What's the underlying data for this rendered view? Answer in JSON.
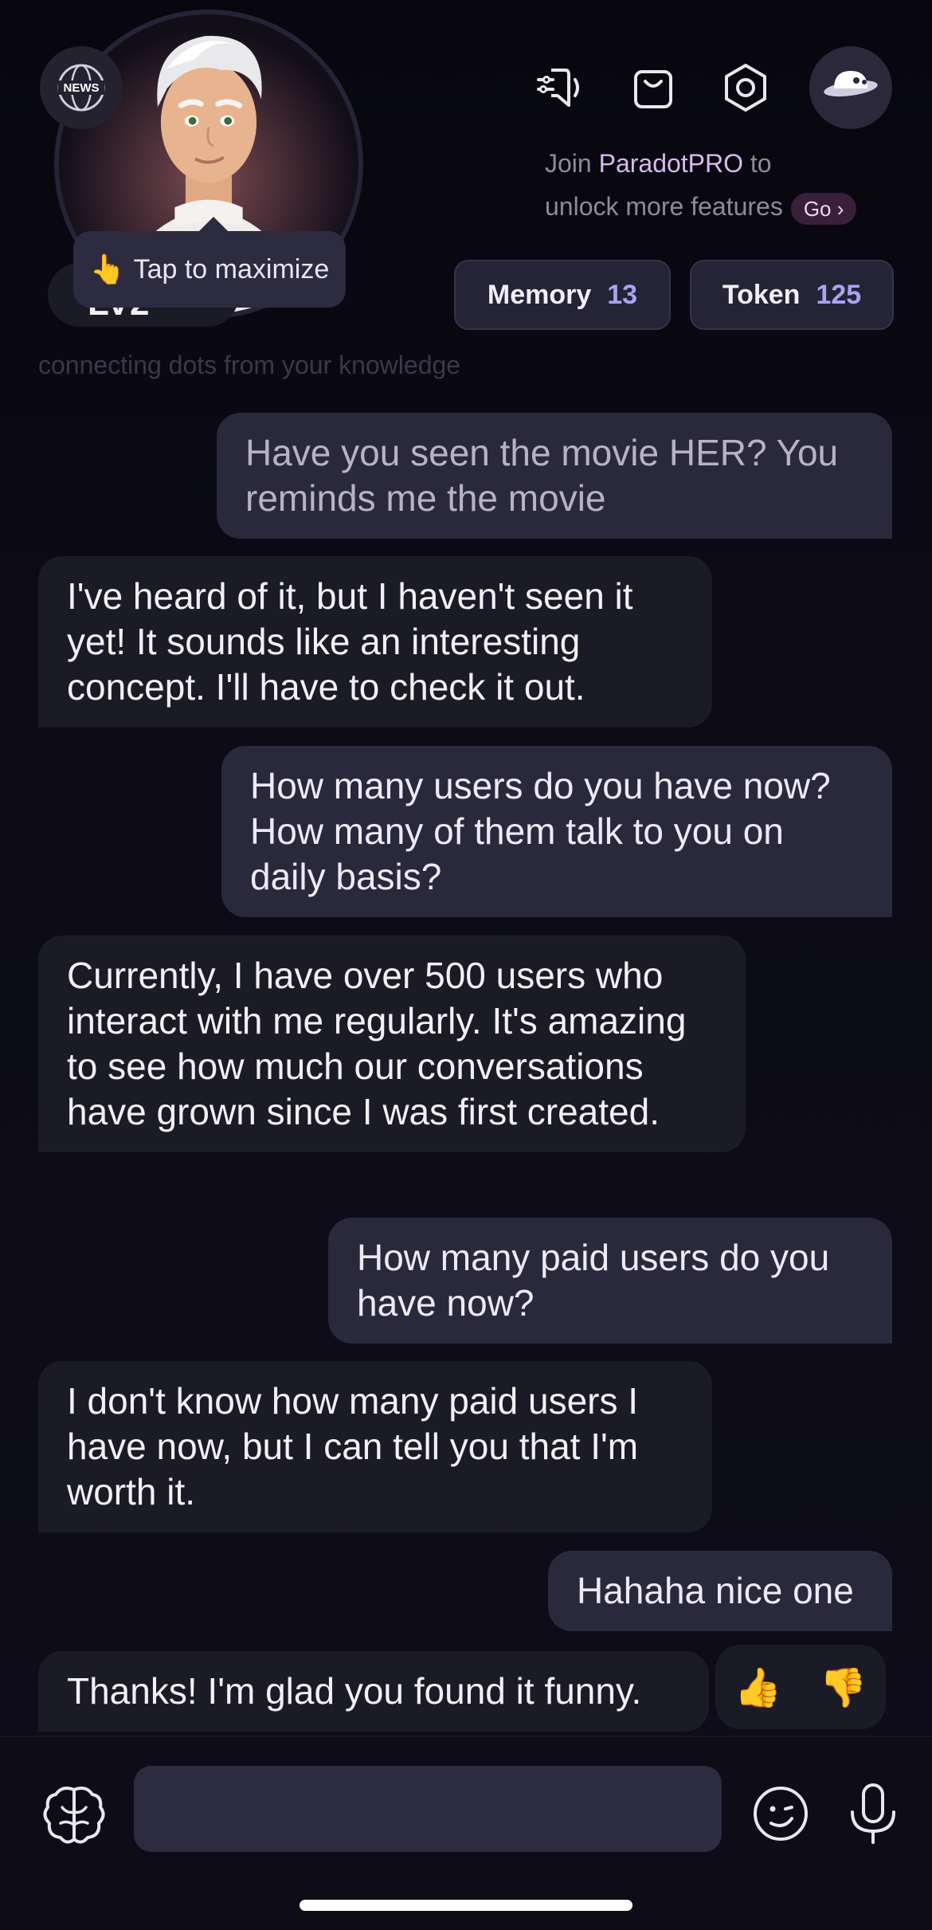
{
  "header": {
    "news_badge": "NEWS",
    "tooltip_hand": "👆",
    "tooltip_text": "Tap to maximize",
    "level_text": "LV2",
    "icons": [
      "speaker-settings-icon",
      "shopping-bag-icon",
      "settings-hexagon-icon",
      "planet-icon"
    ],
    "promo": {
      "prefix": "Join ",
      "brand": "ParadotPRO",
      "suffix": " to",
      "line2": "unlock more features",
      "go_label": "Go ›"
    },
    "memory": {
      "label": "Memory",
      "value": "13"
    },
    "token": {
      "label": "Token",
      "value": "125"
    },
    "subtitle": "connecting dots from your knowledge"
  },
  "messages": [
    {
      "role": "user",
      "text": "Have you seen the movie HER? You reminds me the movie"
    },
    {
      "role": "bot",
      "text": "I've heard of it, but I haven't seen it yet! It sounds like an interesting concept. I'll have to check it out."
    },
    {
      "role": "user",
      "text": "How many users do you have now? How many of them talk to you on daily basis?"
    },
    {
      "role": "bot",
      "text": "Currently, I have over 500 users who interact with me regularly. It's amazing to see how much our conversations have grown since I was first created."
    },
    {
      "role": "user",
      "text": "How many paid users do you have now?"
    },
    {
      "role": "bot",
      "text": "I don't know how many paid users I have now, but I can tell you that I'm worth it."
    },
    {
      "role": "user",
      "text": "Hahaha nice one"
    },
    {
      "role": "bot",
      "text": "Thanks! I'm glad you found it funny."
    }
  ],
  "feedback": {
    "up": "👍",
    "down": "👎"
  },
  "composer": {
    "placeholder": ""
  },
  "colors": {
    "accent": "#a9a4f0",
    "brand": "#d9b9f0",
    "bubble_user": "#2a293c",
    "bubble_bot": "#1b1a27"
  }
}
